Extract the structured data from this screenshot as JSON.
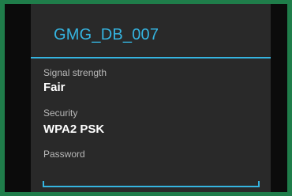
{
  "dialog": {
    "title": "GMG_DB_007",
    "signal": {
      "label": "Signal strength",
      "value": "Fair"
    },
    "security": {
      "label": "Security",
      "value": "WPA2 PSK"
    },
    "password": {
      "label": "Password",
      "value": ""
    }
  },
  "colors": {
    "accent": "#35b4e0",
    "dialog_background": "#292929",
    "frame_border": "#1f7d4a"
  }
}
